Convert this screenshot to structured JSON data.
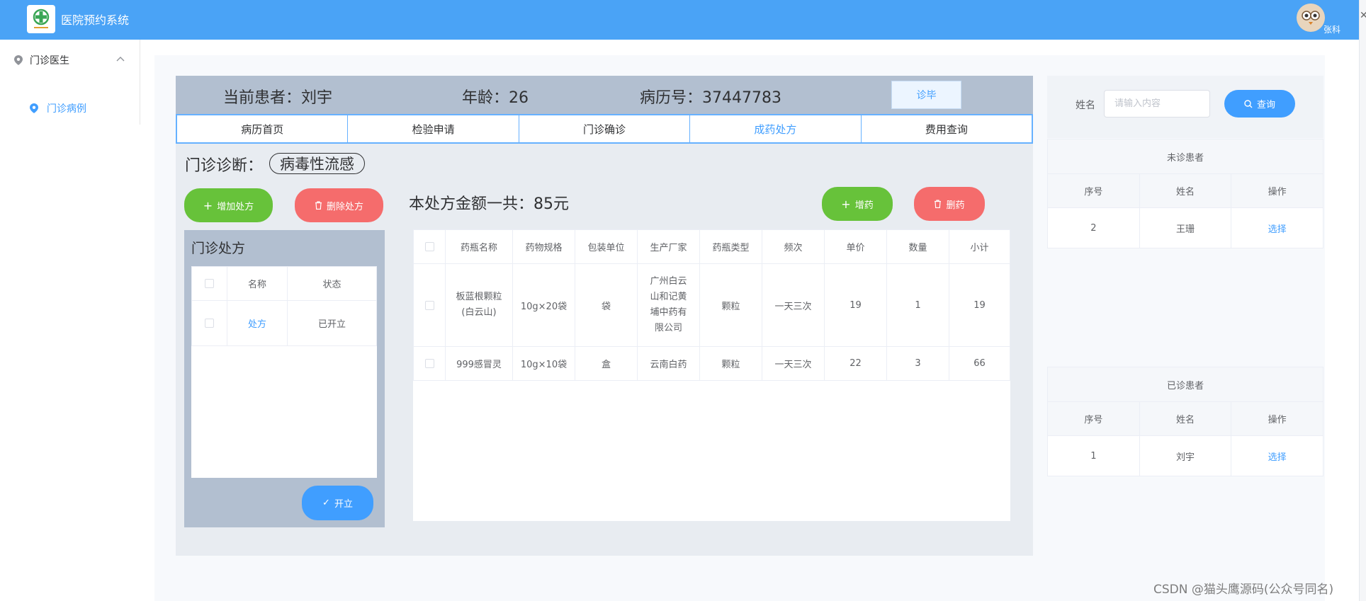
{
  "header": {
    "app_title": "医院预约系统",
    "user_name": "张科"
  },
  "sidebar": {
    "group_label": "门诊医生",
    "item_label": "门诊病例"
  },
  "patient": {
    "name_text": "当前患者：刘宇",
    "age_text": "年龄：26",
    "record_text": "病历号：37447783",
    "finish_label": "诊毕"
  },
  "tabs": [
    {
      "label": "病历首页"
    },
    {
      "label": "检验申请"
    },
    {
      "label": "门诊确诊"
    },
    {
      "label": "成药处方"
    },
    {
      "label": "费用查询"
    }
  ],
  "diagnosis": {
    "label": "门诊诊断：",
    "value": "病毒性流感"
  },
  "actions": {
    "add_rx": "增加处方",
    "delete_rx": "删除处方",
    "add_drug": "增药",
    "delete_drug": "删药",
    "open_label": "开立"
  },
  "total_text": "本处方金额一共：85元",
  "rx_panel": {
    "title": "门诊处方",
    "columns": [
      "名称",
      "状态"
    ],
    "rows": [
      {
        "name": "处方",
        "status": "已开立"
      }
    ]
  },
  "drug_table": {
    "columns": [
      "药瓶名称",
      "药物规格",
      "包装单位",
      "生产厂家",
      "药瓶类型",
      "频次",
      "单价",
      "数量",
      "小计"
    ],
    "rows": [
      [
        "板蓝根颗粒(白云山)",
        "10g×20袋",
        "袋",
        "广州白云山和记黄埔中药有限公司",
        "颗粒",
        "一天三次",
        "19",
        "1",
        "19"
      ],
      [
        "999感冒灵",
        "10g×10袋",
        "盒",
        "云南白药",
        "颗粒",
        "一天三次",
        "22",
        "3",
        "66"
      ]
    ]
  },
  "search": {
    "label": "姓名",
    "placeholder": "请输入内容",
    "button": "查询"
  },
  "pending": {
    "caption": "未诊患者",
    "columns": [
      "序号",
      "姓名",
      "操作"
    ],
    "rows": [
      {
        "no": "2",
        "name": "王珊",
        "action": "选择"
      }
    ]
  },
  "done": {
    "caption": "已诊患者",
    "columns": [
      "序号",
      "姓名",
      "操作"
    ],
    "rows": [
      {
        "no": "1",
        "name": "刘宇",
        "action": "选择"
      }
    ]
  },
  "watermark": "CSDN @猫头鹰源码(公众号同名)",
  "colors": {
    "header": "#4aa3f6",
    "primary": "#409eff",
    "success": "#67c23a",
    "danger": "#f56c6c",
    "panel": "#b2bfd0"
  },
  "icons": [
    "hospital-logo-icon",
    "location-icon",
    "chevron-up-icon",
    "plus-icon",
    "trash-icon",
    "search-icon",
    "check-icon",
    "user-avatar-icon"
  ]
}
